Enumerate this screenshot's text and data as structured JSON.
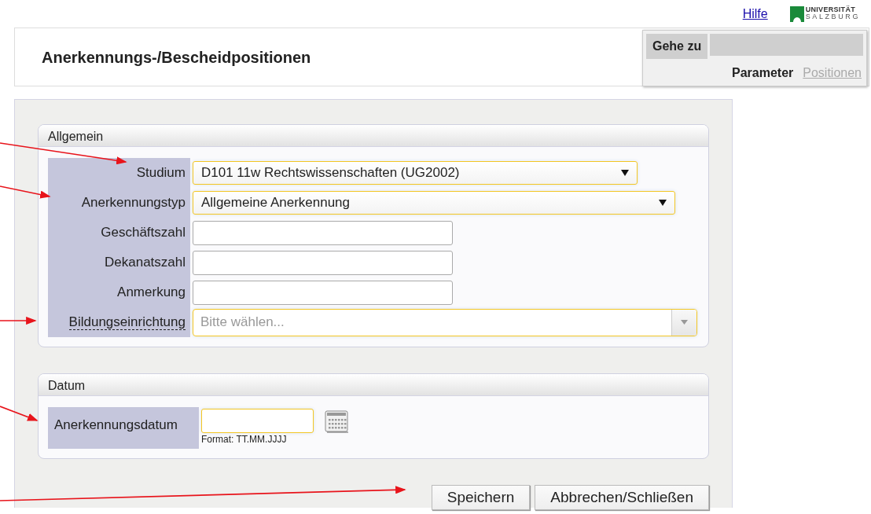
{
  "top_bar": {
    "help_link": "Hilfe",
    "logo": {
      "line_1": "UNIVERSITÄT",
      "line_2": "SALZBURG"
    }
  },
  "header": {
    "title": "Anerkennungs-/Bescheidpositionen"
  },
  "goto_panel": {
    "label": "Gehe zu",
    "links": [
      {
        "label": "Parameter",
        "disabled": false
      },
      {
        "label": "Positionen",
        "disabled": true
      }
    ]
  },
  "sections": [
    {
      "title": "Allgemein",
      "fields": [
        {
          "label": "Studium",
          "kind": "select",
          "value": "D101 11w Rechtswissenschaften (UG2002)",
          "highlighted": true,
          "tooltip": false
        },
        {
          "label": "Anerkennungstyp",
          "kind": "select",
          "value": "Allgemeine Anerkennung",
          "highlighted": true,
          "tooltip": false
        },
        {
          "label": "Geschäftszahl",
          "kind": "text",
          "highlighted": false,
          "tooltip": false
        },
        {
          "label": "Dekanatszahl",
          "kind": "text",
          "highlighted": false,
          "tooltip": false
        },
        {
          "label": "Anmerkung",
          "kind": "text",
          "highlighted": false,
          "tooltip": false
        },
        {
          "label": "Bildungseinrichtung",
          "kind": "combo",
          "placeholder": "Bitte wählen...",
          "highlighted": true,
          "tooltip": true
        }
      ]
    },
    {
      "title": "Datum",
      "fields": [
        {
          "label": "Anerkennungsdatum",
          "kind": "date",
          "hint": "Format: TT.MM.JJJJ",
          "highlighted": true,
          "tooltip": false
        }
      ]
    }
  ],
  "buttons": [
    "Speichern",
    "Abbrechen/Schließen"
  ]
}
